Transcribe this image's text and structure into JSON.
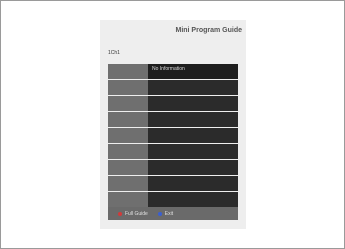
{
  "guide": {
    "title": "Mini Program Guide",
    "channel": "1Ch1",
    "rows": [
      {
        "time": "",
        "program": "No Information"
      },
      {
        "time": "",
        "program": ""
      },
      {
        "time": "",
        "program": ""
      },
      {
        "time": "",
        "program": ""
      },
      {
        "time": "",
        "program": ""
      },
      {
        "time": "",
        "program": ""
      },
      {
        "time": "",
        "program": ""
      },
      {
        "time": "",
        "program": ""
      },
      {
        "time": "",
        "program": ""
      }
    ]
  },
  "footer": {
    "full_guide_label": "Full Guide",
    "full_guide_color": "#d23a3a",
    "exit_label": "Exit",
    "exit_color": "#3a5fd2"
  }
}
